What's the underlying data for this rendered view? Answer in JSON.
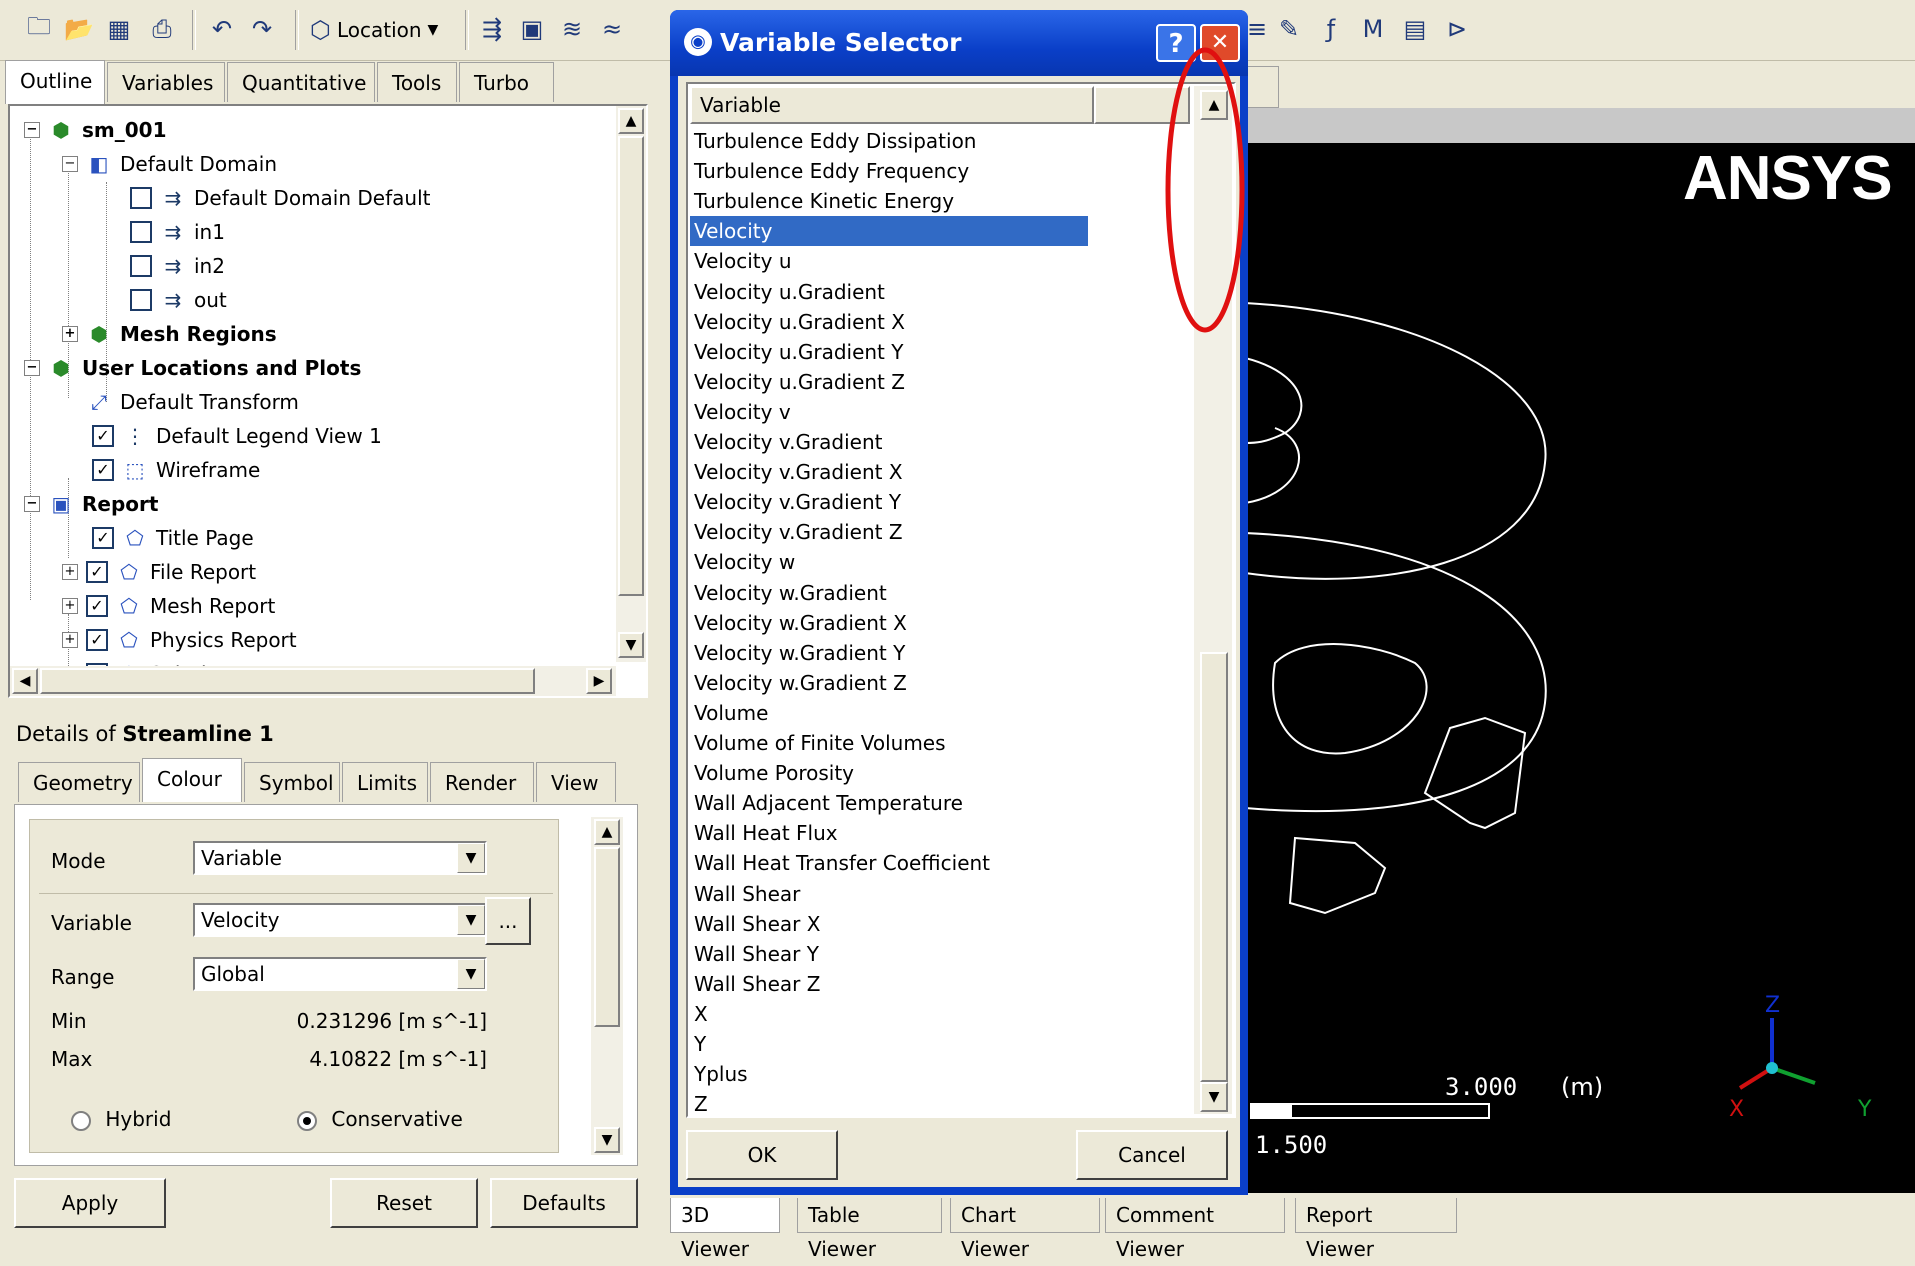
{
  "toolbar": {
    "location_label": "Location",
    "icons": [
      "new-icon",
      "open-icon",
      "save-state-icon",
      "print-icon",
      "undo-icon",
      "redo-icon",
      "location-icon",
      "vector-icon",
      "contour-icon",
      "streamline-icon",
      "isosurface-icon",
      "probe-icon",
      "expression-icon",
      "macro-icon",
      "variable-icon",
      "command-icon"
    ]
  },
  "left_tabs": [
    "Outline",
    "Variables",
    "Quantitative",
    "Tools",
    "Turbo"
  ],
  "tree": {
    "root": "sm_001",
    "default_domain": "Default Domain",
    "domain_children": [
      "Default Domain Default",
      "in1",
      "in2",
      "out"
    ],
    "mesh_regions": "Mesh Regions",
    "user_locations": "User Locations and Plots",
    "default_transform": "Default Transform",
    "legend_view": "Default Legend View 1",
    "wireframe": "Wireframe",
    "report": "Report",
    "report_children": [
      "Title Page",
      "File Report",
      "Mesh Report",
      "Physics Report",
      "Solution Report"
    ]
  },
  "details": {
    "prefix": "Details of",
    "object": "Streamline 1",
    "tabs": [
      "Geometry",
      "Colour",
      "Symbol",
      "Limits",
      "Render",
      "View"
    ],
    "mode_label": "Mode",
    "mode_value": "Variable",
    "variable_label": "Variable",
    "variable_value": "Velocity",
    "ellipsis": "...",
    "range_label": "Range",
    "range_value": "Global",
    "min_label": "Min",
    "min_value": "0.231296 [m s^-1]",
    "max_label": "Max",
    "max_value": "4.10822 [m s^-1]",
    "hybrid_label": "Hybrid",
    "conservative_label": "Conservative",
    "apply": "Apply",
    "reset": "Reset",
    "defaults": "Defaults"
  },
  "dialog": {
    "title": "Variable Selector",
    "help": "?",
    "close": "✕",
    "column_header": "Variable",
    "selected": "Velocity",
    "items": [
      "Turbulence Eddy Dissipation",
      "Turbulence Eddy Frequency",
      "Turbulence Kinetic Energy",
      "Velocity",
      "Velocity u",
      "Velocity u.Gradient",
      "Velocity u.Gradient X",
      "Velocity u.Gradient Y",
      "Velocity u.Gradient Z",
      "Velocity v",
      "Velocity v.Gradient",
      "Velocity v.Gradient X",
      "Velocity v.Gradient Y",
      "Velocity v.Gradient Z",
      "Velocity w",
      "Velocity w.Gradient",
      "Velocity w.Gradient X",
      "Velocity w.Gradient Y",
      "Velocity w.Gradient Z",
      "Volume",
      "Volume of Finite Volumes",
      "Volume Porosity",
      "Wall Adjacent Temperature",
      "Wall Heat Flux",
      "Wall Heat Transfer Coefficient",
      "Wall Shear",
      "Wall Shear X",
      "Wall Shear Y",
      "Wall Shear Z",
      "X",
      "Y",
      "Yplus",
      "Z"
    ],
    "ok": "OK",
    "cancel": "Cancel"
  },
  "viewer": {
    "logo": "ANSYS",
    "scale_top": "3.000",
    "scale_unit": "(m)",
    "scale_mid": "1.500",
    "axis_x": "X",
    "axis_y": "Y",
    "axis_z": "Z"
  },
  "bottom_tabs": [
    "3D Viewer",
    "Table Viewer",
    "Chart Viewer",
    "Comment Viewer",
    "Report Viewer"
  ],
  "colors": {
    "dialog_title": "#0a3fc8",
    "selection": "#316ac5",
    "annotation": "#e01010"
  }
}
